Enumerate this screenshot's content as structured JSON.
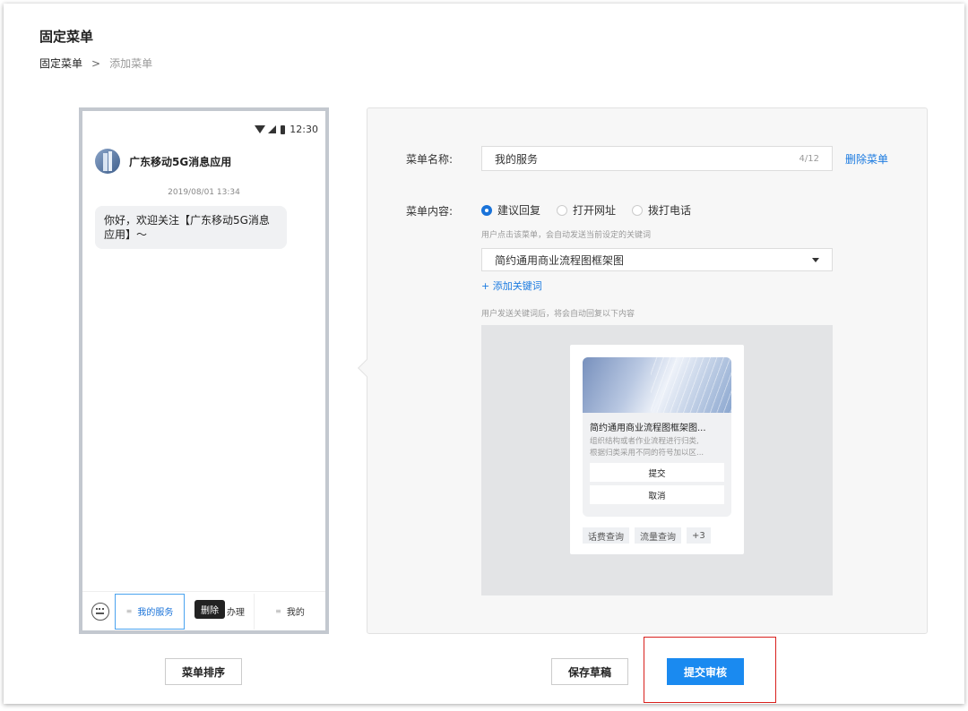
{
  "page": {
    "title": "固定菜单",
    "breadcrumb": {
      "parent": "固定菜单",
      "separator": ">",
      "current": "添加菜单"
    }
  },
  "phone": {
    "status_time": "12:30",
    "app_name": "广东移动5G消息应用",
    "chat_time": "2019/08/01 13:34",
    "message": "你好，欢迎关注【广东移动5G消息应用】～",
    "menu_tabs": [
      {
        "label": "我的服务",
        "lines": "≡",
        "active": true
      },
      {
        "label": "办理",
        "lines": "≡"
      },
      {
        "label": "我的",
        "lines": "≡"
      }
    ],
    "delete_tooltip": "删除"
  },
  "editor": {
    "name_label": "菜单名称:",
    "name_value": "我的服务",
    "name_count": "4/12",
    "delete_menu": "删除菜单",
    "content_label": "菜单内容:",
    "radios": [
      {
        "label": "建议回复",
        "checked": true
      },
      {
        "label": "打开网址",
        "checked": false
      },
      {
        "label": "拨打电话",
        "checked": false
      }
    ],
    "hint_keyword": "用户点击该菜单，会自动发送当前设定的关键词",
    "keyword_value": "简约通用商业流程图框架图",
    "add_keyword": "+ 添加关键词",
    "hint_reply": "用户发送关键词后，将会自动回复以下内容"
  },
  "card": {
    "title": "简约通用商业流程图框架图...",
    "desc_line1": "组织结构或者作业流程进行归类,",
    "desc_line2": "根据归类采用不同的符号加以区...",
    "buttons": [
      "提交",
      "取消"
    ],
    "chips": [
      "话费查询",
      "流量查询",
      "+3"
    ]
  },
  "actions": {
    "sort_menu": "菜单排序",
    "save_draft": "保存草稿",
    "submit_review": "提交审核"
  },
  "colors": {
    "accent": "#1a8af0",
    "highlight": "#d8201d",
    "phone_border": "#c3c8cf"
  }
}
